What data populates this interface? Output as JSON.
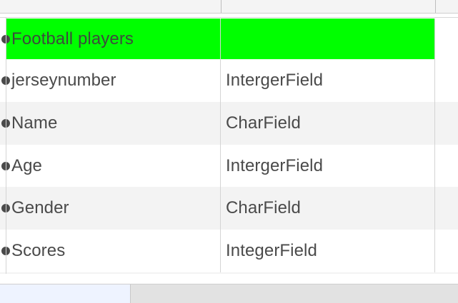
{
  "table": {
    "rows": [
      {
        "col1": "Football  players",
        "col2": "",
        "highlight": "#00ff00"
      },
      {
        "col1": "jerseynumber",
        "col2": "IntergerField"
      },
      {
        "col1": "Name",
        "col2": "CharField"
      },
      {
        "col1": "Age",
        "col2": "IntergerField"
      },
      {
        "col1": "Gender",
        "col2": "CharField"
      },
      {
        "col1": "Scores",
        "col2": "IntegerField"
      }
    ]
  },
  "colors": {
    "highlight": "#00ff00",
    "text": "#4a4a4a",
    "stripe": "#f3f3f3",
    "status_bar": "#e2e2e2",
    "sheet_tab": "#eef3ff"
  }
}
